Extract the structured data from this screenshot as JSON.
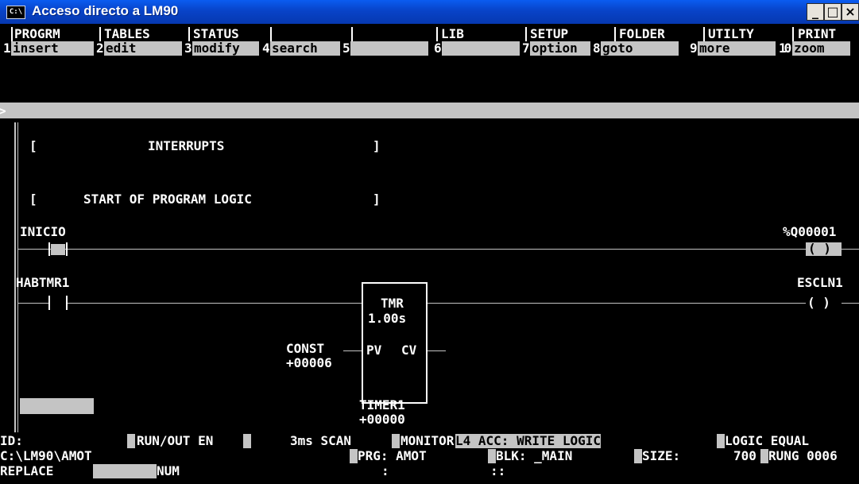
{
  "window": {
    "title": "Acceso directo a LM90",
    "icon_text": "C:\\",
    "min_label": "_",
    "max_label": "□",
    "close_label": "×"
  },
  "menu": {
    "categories": [
      "PROGRM",
      "TABLES",
      "STATUS",
      "",
      "",
      "LIB",
      "SETUP",
      "FOLDER",
      "UTILTY",
      "PRINT"
    ],
    "keys": [
      {
        "num": "1",
        "label": "insert"
      },
      {
        "num": "2",
        "label": "edit"
      },
      {
        "num": "3",
        "label": "modify"
      },
      {
        "num": "4",
        "label": "search"
      },
      {
        "num": "5",
        "label": ""
      },
      {
        "num": "6",
        "label": ""
      },
      {
        "num": "7",
        "label": "option"
      },
      {
        "num": "8",
        "label": "goto"
      },
      {
        "num": "9",
        "label": "more"
      },
      {
        "num": "10",
        "label": "zoom"
      }
    ]
  },
  "command_line": {
    "prompt": ">",
    "value": ""
  },
  "ladder": {
    "comment1": {
      "open": "[",
      "text": "INTERRUPTS",
      "close": "]"
    },
    "comment2": {
      "open": "[",
      "text": "START OF PROGRAM LOGIC",
      "close": "]"
    },
    "rung1": {
      "contact": "INICIO",
      "coil": "%Q00001",
      "coil_symbol": "( )"
    },
    "rung2": {
      "contact": "HABTMR1",
      "coil": "ESCLN1",
      "coil_symbol": "( )",
      "timer": {
        "type": "TMR",
        "base": "1.00s",
        "pv": "PV",
        "cv": "CV",
        "name": "TIMER1",
        "value": "+00000"
      },
      "const": {
        "label": "CONST",
        "value": "+00006"
      }
    }
  },
  "status": {
    "row1": {
      "id": "ID:",
      "mode": "RUN/OUT EN",
      "scan": "3ms SCAN",
      "monitor": "MONITOR",
      "acc": "L4 ACC: WRITE LOGIC",
      "logic": "LOGIC EQUAL"
    },
    "row2": {
      "path": "C:\\LM90\\AMOT",
      "prg": "PRG: AMOT",
      "blk": "BLK: _MAIN",
      "size_label": "SIZE:",
      "size_value": "700",
      "rung": "RUNG 0006"
    },
    "row3": {
      "mode": "REPLACE",
      "num": "NUM",
      "sep1": ":",
      "sep2": "::"
    }
  }
}
